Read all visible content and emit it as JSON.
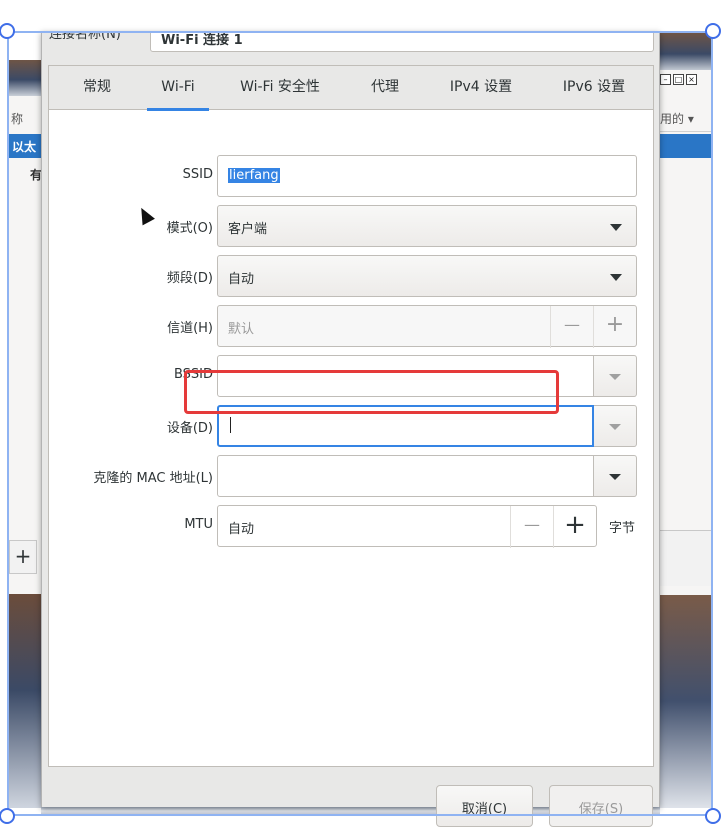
{
  "colors": {
    "accent": "#3584e4",
    "selection_frame": "#3f6ee8",
    "highlight": "#e53a3a"
  },
  "background": {
    "left_list_header": "称",
    "left_list_selected": "以太",
    "left_list_item": "有",
    "right_column_header": "用的 ▾",
    "add_button": "+"
  },
  "dialog": {
    "name_label": "连接名称(N)",
    "name_value": "Wi-Fi 连接 1",
    "tabs": [
      {
        "label": "常规"
      },
      {
        "label": "Wi-Fi",
        "active": true
      },
      {
        "label": "Wi-Fi 安全性"
      },
      {
        "label": "代理"
      },
      {
        "label": "IPv4 设置"
      },
      {
        "label": "IPv6 设置"
      }
    ],
    "fields": {
      "ssid": {
        "label": "SSID",
        "value": "lierfang"
      },
      "mode": {
        "label": "模式(O)",
        "value": "客户端"
      },
      "band": {
        "label": "频段(D)",
        "value": "自动"
      },
      "channel": {
        "label": "信道(H)",
        "value": "默认",
        "minus": "—",
        "plus": "+"
      },
      "bssid": {
        "label": "BSSID",
        "value": ""
      },
      "device": {
        "label": "设备(D)",
        "value": ""
      },
      "cloned_mac": {
        "label": "克隆的 MAC 地址(L)",
        "value": ""
      },
      "mtu": {
        "label": "MTU",
        "value": "自动",
        "minus": "—",
        "plus": "+",
        "unit": "字节"
      }
    },
    "buttons": {
      "cancel": "取消(C)",
      "save": "保存(S)"
    }
  }
}
